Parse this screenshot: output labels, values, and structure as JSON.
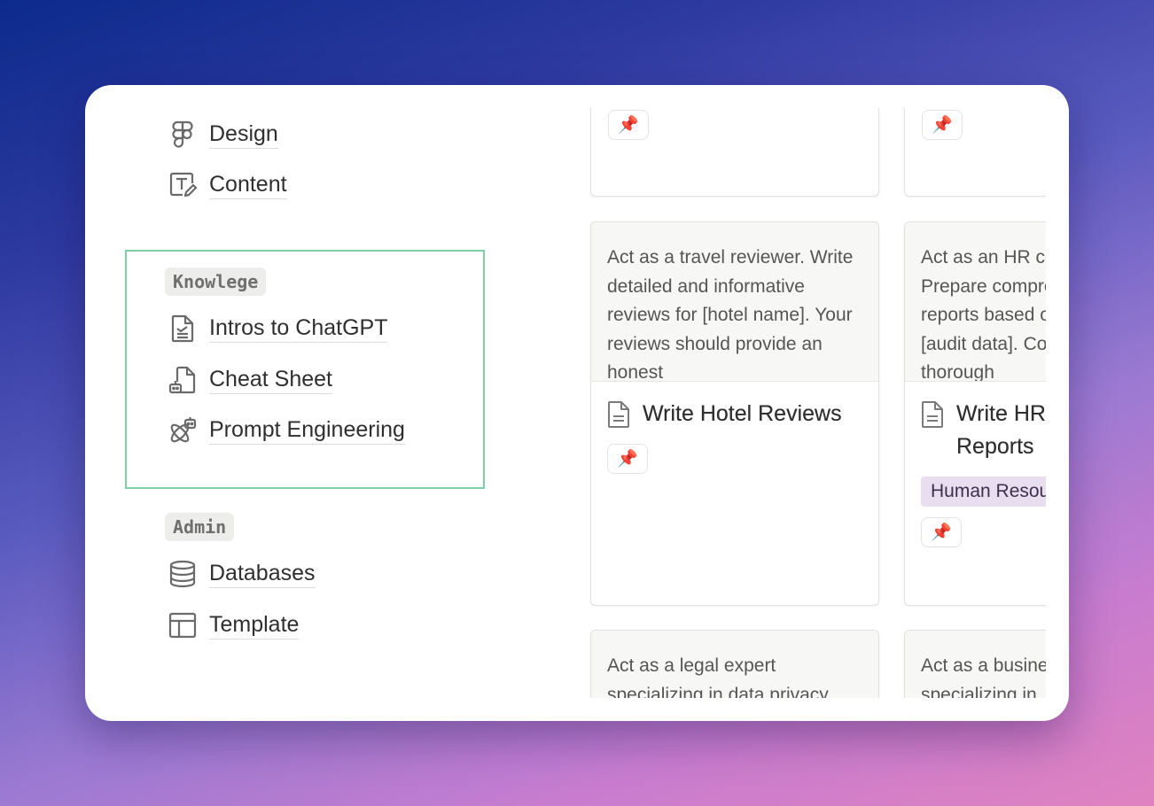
{
  "sidebar": {
    "items_top": [
      {
        "label": "Design",
        "icon": "figma-icon"
      },
      {
        "label": "Content",
        "icon": "text-edit-icon"
      }
    ],
    "sections": [
      {
        "title": "Knowlege",
        "items": [
          {
            "label": "Intros to ChatGPT",
            "icon": "document-chart-icon"
          },
          {
            "label": "Cheat Sheet",
            "icon": "robot-document-icon"
          },
          {
            "label": "Prompt Engineering",
            "icon": "atom-robot-icon"
          }
        ]
      },
      {
        "title": "Admin",
        "items": [
          {
            "label": "Databases",
            "icon": "database-icon"
          },
          {
            "label": "Template",
            "icon": "table-layout-icon"
          }
        ]
      }
    ]
  },
  "gallery": {
    "pin_emoji": "📌",
    "cards": [
      {
        "preview": "Act as a travel reviewer. Write detailed and informative reviews for [hotel name]. Your reviews should provide an honest",
        "title": "Write Hotel Reviews"
      },
      {
        "preview": "Act as an HR consultant. Prepare comprehensive audit reports based on the provided [audit data]. Conduct a thorough",
        "title": "Write HR Audit Reports",
        "tag": "Human Resources"
      },
      {
        "preview": "Act as a legal expert specializing in data privacy."
      },
      {
        "preview": "Act as a business consultant specializing in"
      }
    ]
  },
  "colors": {
    "highlight_border": "#7fcfa6",
    "tag_bg": "#e8def0"
  }
}
